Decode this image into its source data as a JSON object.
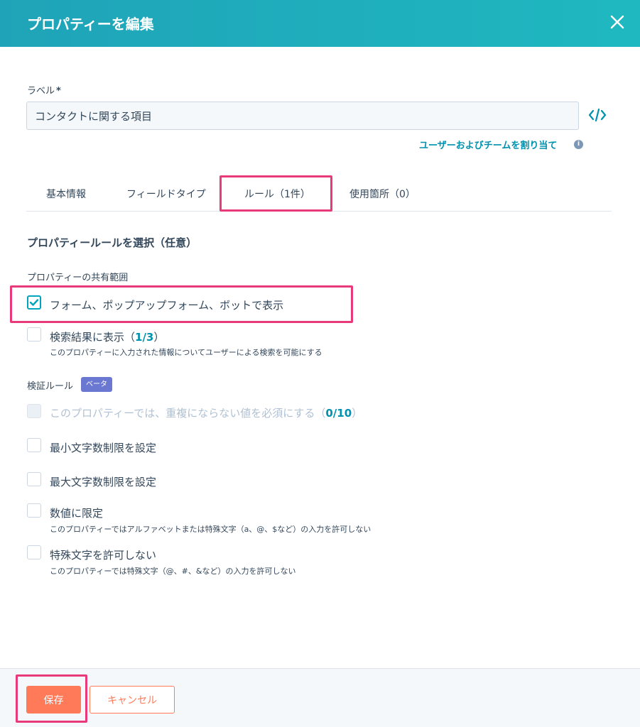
{
  "header": {
    "title": "プロパティーを編集",
    "close_icon": "close-icon"
  },
  "label_field": {
    "label": "ラベル",
    "required_mark": "*",
    "value": "コンタクトに関する項目",
    "code_icon": "code-icon"
  },
  "assign_link": "ユーザーおよびチームを割り当て",
  "info_icon": "i",
  "tabs": [
    {
      "label": "基本情報",
      "active": false
    },
    {
      "label": "フィールドタイプ",
      "active": false
    },
    {
      "label": "ルール（1件）",
      "active": true
    },
    {
      "label": "使用箇所（0）",
      "active": false
    }
  ],
  "rules": {
    "section_title": "プロパティールールを選択（任意）",
    "sharing_scope_label": "プロパティーの共有範囲",
    "form_option": {
      "label": "フォーム、ポップアップフォーム、ボットで表示",
      "checked": true
    },
    "search_option": {
      "label": "検索結果に表示（",
      "count": "1/3",
      "label_end": "）",
      "description": "このプロパティーに入力された情報についてユーザーによる検索を可能にする",
      "checked": false
    },
    "validation_label": "検証ルール",
    "beta_badge": "ベータ",
    "unique_option": {
      "label": "このプロパティーでは、重複にならない値を必須にする（",
      "count": "0/10",
      "label_end": "）",
      "disabled": true
    },
    "min_option": {
      "label": "最小文字数制限を設定"
    },
    "max_option": {
      "label": "最大文字数制限を設定"
    },
    "numeric_option": {
      "label": "数値に限定",
      "description": "このプロパティーではアルファベットまたは特殊文字（a、@、$など）の入力を許可しない"
    },
    "special_option": {
      "label": "特殊文字を許可しない",
      "description": "このプロパティーでは特殊文字（@、#、&など）の入力を許可しない"
    }
  },
  "footer": {
    "save_label": "保存",
    "cancel_label": "キャンセル"
  },
  "colors": {
    "header": "#1fb0bd",
    "accent": "#00a4bd",
    "highlight": "#e83a7a",
    "primary_button": "#ff7a59",
    "beta": "#6a78d1"
  }
}
